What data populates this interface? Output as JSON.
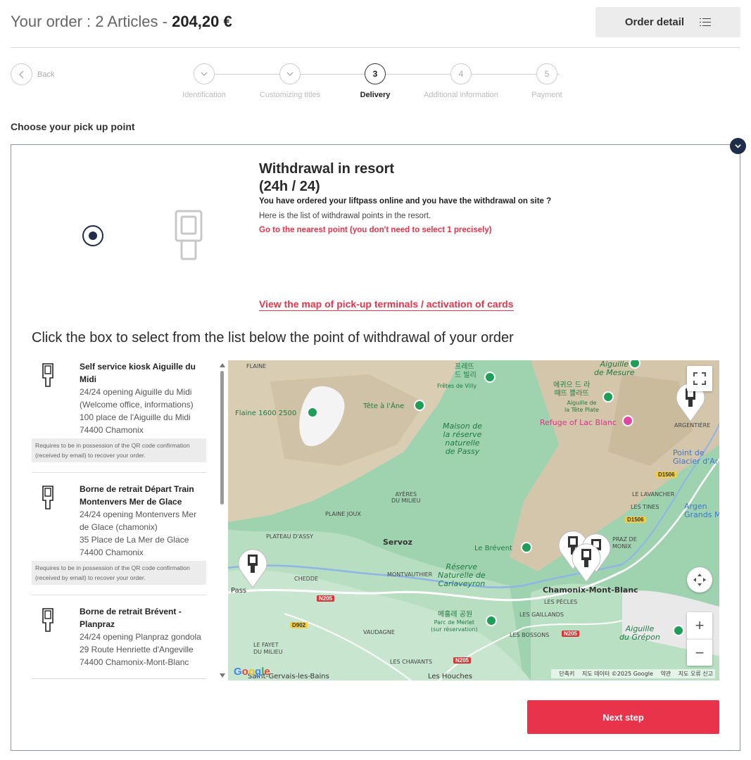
{
  "header": {
    "order_prefix": "Your order : 2 Articles - ",
    "order_total": "204,20 €",
    "order_detail_label": "Order detail"
  },
  "back": {
    "label": "Back"
  },
  "stepper": {
    "steps": [
      {
        "number": "1",
        "label": "Identification",
        "state": "done"
      },
      {
        "number": "2",
        "label": "Customizing titles",
        "state": "done"
      },
      {
        "number": "3",
        "label": "Delivery",
        "state": "active"
      },
      {
        "number": "4",
        "label": "Additional information",
        "state": "todo"
      },
      {
        "number": "5",
        "label": "Payment",
        "state": "todo"
      }
    ]
  },
  "section_title": "Choose your pick up point",
  "withdrawal": {
    "title_line1": "Withdrawal in resort",
    "title_line2": "(24h / 24)",
    "question": "You have ordered your liftpass online and you have the withdrawal on site ?",
    "list_text": "Here is the list of withdrawal points in the resort.",
    "go_text": "Go to the nearest point (you don't need to select 1 precisely)",
    "map_link": "View the map of pick-up terminals / activation of cards"
  },
  "click_title": "Click the box to select from the list below the point of withdrawal of your order",
  "points": [
    {
      "name": "Self service kiosk Aiguille du Midi",
      "lines": [
        "24/24 opening Aiguille du Midi (Welcome office, informations)",
        "100 place de l'Aiguille du Midi",
        "74400 Chamonix"
      ],
      "note": "Requires to be in possession of the QR code confirmation (received by email) to recover your order."
    },
    {
      "name": "Borne de retrait Départ Train Montenvers Mer de Glace",
      "lines": [
        "24/24 opening Montenvers Mer de Glace (chamonix)",
        "35 Place de La Mer de Glace",
        "74400 Chamonix"
      ],
      "note": "Requires to be in possession of the QR code confirmation (received by email) to recover your order."
    },
    {
      "name": "Borne de retrait Brévent - Planpraz",
      "lines": [
        "24/24 opening Planpraz gondola",
        "29 Route Henriette d'Angeville",
        "74400 Chamonix-Mont-Blanc"
      ],
      "note": ""
    }
  ],
  "map": {
    "labels": {
      "flaine": "FLAINE",
      "flaine1600": "Flaine 1600 2500",
      "tete_ane": "Tête à l'Âne",
      "fretes_ko": "프레뜨\n드 빌리",
      "fretes": "Frêtes de Villy",
      "aiguille_mesure": "Aiguille\nde Mesure",
      "aiguille_tete_ko": "에귀으 드 라\n떼뜨 쁠라뜨",
      "aiguille_tete": "Aiguille de\nla Tête Plate",
      "refuge": "Refuge of Lac Blanc",
      "maison": "Maison de\nla réserve\nnaturelle\nde Passy",
      "argentiere": "ARGENTIÈRE",
      "point_glacier": "Point de\nGlacier d'Ar",
      "d1506a": "D1506",
      "d1506b": "D1506",
      "lavancher": "LE LAVANCHER",
      "tines": "LES TINES",
      "argent": "Argen\nGrands M",
      "ayeres": "AYÈRES\nDU MILIEU",
      "plaine_joux": "PLAINE JOUX",
      "plateau_assy": "PLATEAU D'ASSY",
      "servoz": "Servoz",
      "le_brevent": "Le Brévent",
      "praz": "PRAZ DE\nMONIX",
      "chedde": "CHEDDE",
      "montvauthier": "MONTVAUTHIER",
      "reserve_carla": "Réserve\nNaturelle de\nCarlaveyron",
      "chamonix": "Chamonix-Mont-Blanc",
      "pass": "Pass",
      "n205a": "N205",
      "n205b": "N205",
      "n205c": "N205",
      "d902": "D902",
      "vaudagne": "VAUDAGNE",
      "pelerins": "LES PÈCLES",
      "gaillands": "LES GAILLANDS",
      "bossons": "LES BOSSONS",
      "parc_merlet_ko": "메흘레 공원",
      "parc_merlet": "Parc de Merlet\n(sur réservation)",
      "fayet": "LE FAYET\nDU MILIEU",
      "chavants": "LES CHAVANTS",
      "aiguille_grepon": "Aiguille\ndu Grépon",
      "st_gervais": "Saint-Gervais-les-Bains",
      "houches": "Les Houches"
    },
    "google": "Google",
    "footer": [
      "단축키",
      "지도 데이터 ©2025 Google",
      "약관",
      "지도 오류 신고"
    ],
    "zoom_in": "+",
    "zoom_out": "−"
  },
  "next_button": "Next step",
  "colors": {
    "accent": "#e8334a",
    "navy": "#1f2d4a"
  }
}
